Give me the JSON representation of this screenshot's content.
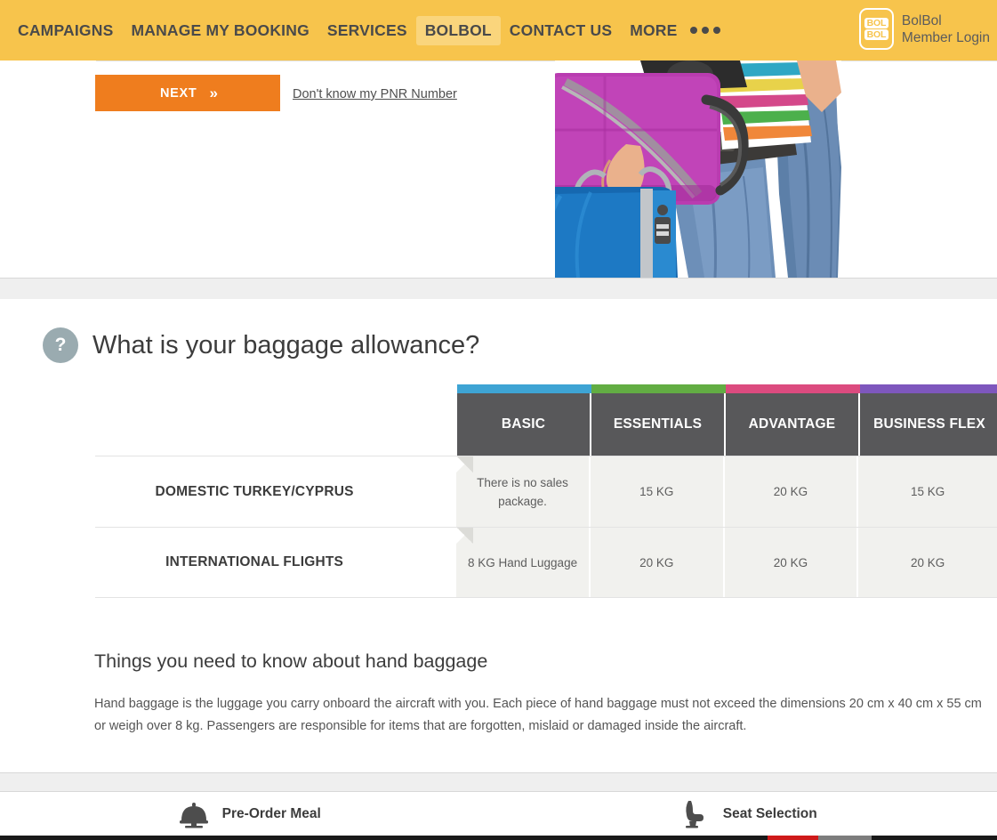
{
  "nav": {
    "items": [
      {
        "label": "CAMPAIGNS",
        "active": false
      },
      {
        "label": "MANAGE MY BOOKING",
        "active": false
      },
      {
        "label": "SERVICES",
        "active": false
      },
      {
        "label": "BOLBOL",
        "active": true
      },
      {
        "label": "CONTACT US",
        "active": false
      },
      {
        "label": "MORE",
        "active": false
      }
    ],
    "more_icon": "ellipsis-icon",
    "logo": {
      "line1": "BOL",
      "line2": "BOL"
    },
    "member": {
      "line1": "BolBol",
      "line2": "Member Login"
    }
  },
  "hero": {
    "next_button": {
      "label": "NEXT",
      "chevron": "»"
    },
    "pnr_link": "Don't know my PNR Number",
    "image_alt": "traveller-with-luggage"
  },
  "baggage": {
    "question_icon": "question-mark-icon",
    "question": "What is your baggage allowance?",
    "table": {
      "columns": [
        {
          "label": "BASIC",
          "color": "#3ea4d4"
        },
        {
          "label": "ESSENTIALS",
          "color": "#62ad43"
        },
        {
          "label": "ADVANTAGE",
          "color": "#dc4b7f"
        },
        {
          "label": "BUSINESS FLEX",
          "color": "#7e57bd"
        }
      ],
      "rows": [
        {
          "label": "DOMESTIC TURKEY/CYPRUS",
          "cells": [
            "There is no sales package.",
            "15 KG",
            "20 KG",
            "15 KG"
          ]
        },
        {
          "label": "INTERNATIONAL FLIGHTS",
          "cells": [
            "8 KG Hand Luggage",
            "20 KG",
            "20 KG",
            "20 KG"
          ]
        }
      ]
    },
    "info_title": "Things you need to know about hand baggage",
    "info_body": "Hand baggage is the luggage you carry onboard the aircraft with you. Each piece of hand baggage must not exceed the dimensions 20 cm x 40 cm x 55 cm or weigh over 8 kg. Passengers are responsible for items that are forgotten, mislaid or damaged inside the aircraft."
  },
  "footer": {
    "tabs": [
      {
        "label": "Pre-Order Meal",
        "icon": "meal-dome-icon"
      },
      {
        "label": "Seat Selection",
        "icon": "seat-icon"
      }
    ]
  },
  "colors": {
    "brand_yellow": "#f7c44c",
    "accent_orange": "#ef7d1e",
    "header_grey": "#58585a",
    "cell_grey": "#f1f1ee"
  }
}
